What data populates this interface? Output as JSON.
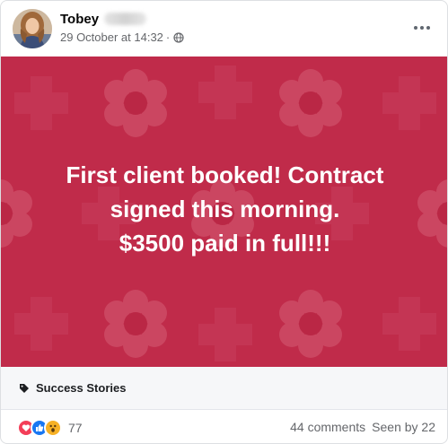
{
  "post": {
    "author_name": "Tobey",
    "timestamp": "29 October at 14:32",
    "meta_separator": "·",
    "privacy_icon": "globe-icon",
    "more_icon": "more-horizontal-icon"
  },
  "media": {
    "background_color": "#c02b4a",
    "pattern_color": "#cc4f67",
    "text_lines": [
      "First client booked! Contract",
      "signed this morning.",
      "$3500 paid in full!!!"
    ]
  },
  "tag": {
    "icon": "tag-icon",
    "label": "Success Stories"
  },
  "footer": {
    "reactions": [
      "love",
      "like",
      "wow"
    ],
    "reaction_count": "77",
    "comments": "44 comments",
    "seen_by": "Seen by 22"
  }
}
